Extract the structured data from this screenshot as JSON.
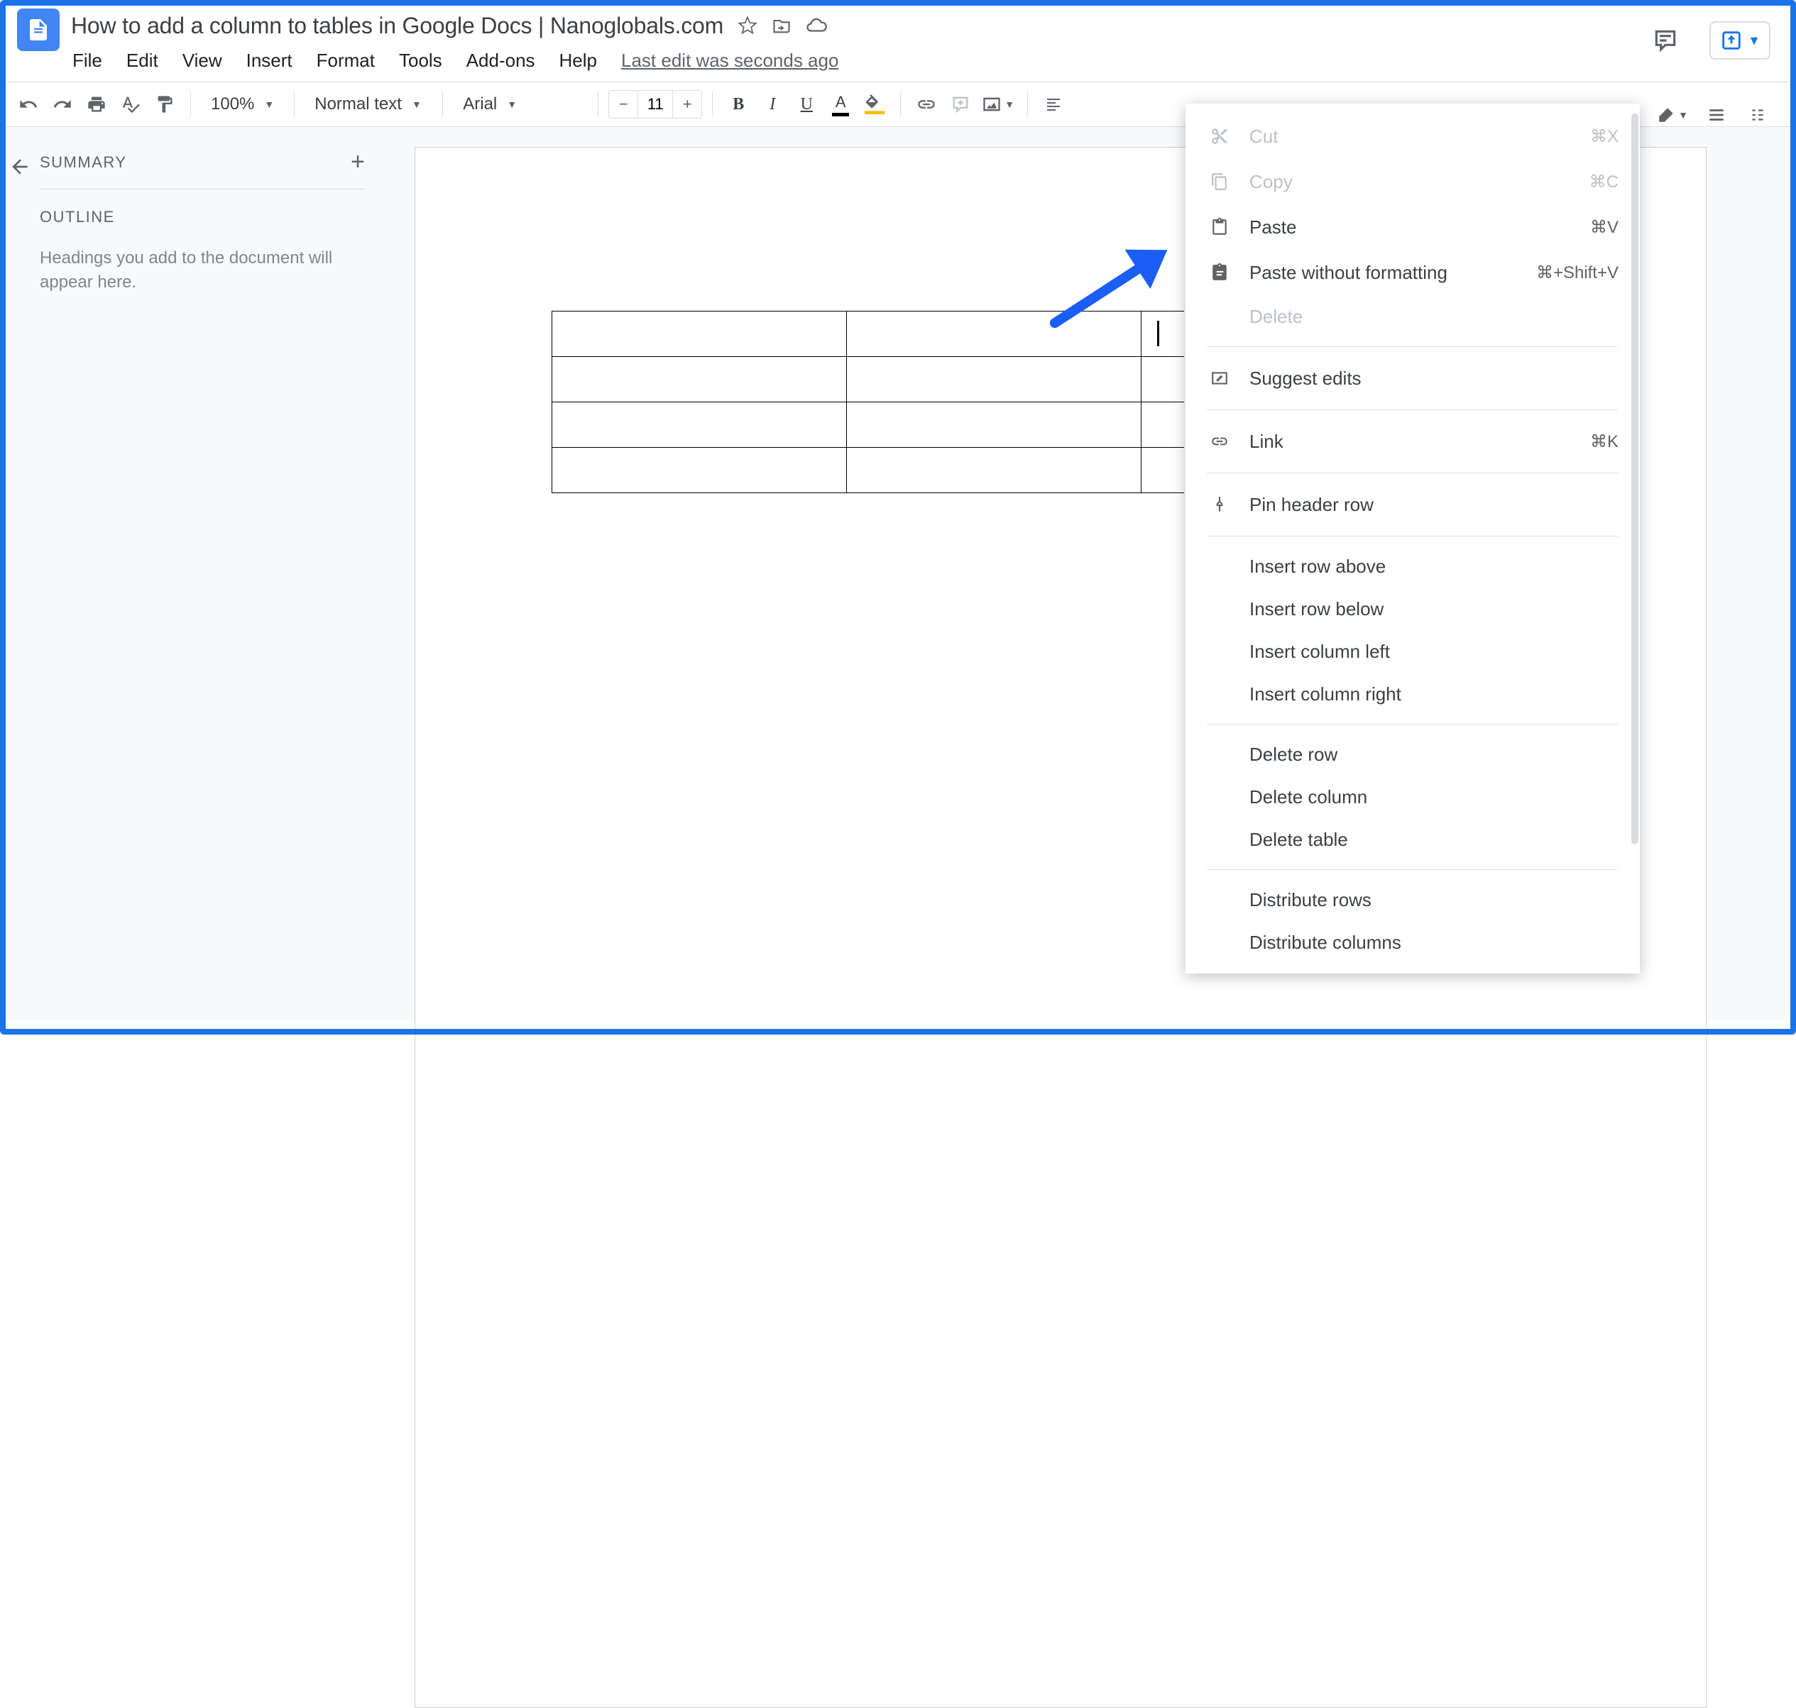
{
  "header": {
    "title": "How to add a column to tables in Google Docs | Nanoglobals.com",
    "menus": [
      "File",
      "Edit",
      "View",
      "Insert",
      "Format",
      "Tools",
      "Add-ons",
      "Help"
    ],
    "last_edit": "Last edit was seconds ago"
  },
  "toolbar": {
    "zoom": "100%",
    "style": "Normal text",
    "font": "Arial",
    "font_size": "11"
  },
  "outline": {
    "summary_label": "SUMMARY",
    "outline_label": "OUTLINE",
    "hint": "Headings you add to the document will appear here."
  },
  "context_menu": {
    "cut": {
      "label": "Cut",
      "shortcut": "⌘X"
    },
    "copy": {
      "label": "Copy",
      "shortcut": "⌘C"
    },
    "paste": {
      "label": "Paste",
      "shortcut": "⌘V"
    },
    "paste_nofmt": {
      "label": "Paste without formatting",
      "shortcut": "⌘+Shift+V"
    },
    "delete": {
      "label": "Delete"
    },
    "suggest": {
      "label": "Suggest edits"
    },
    "link": {
      "label": "Link",
      "shortcut": "⌘K"
    },
    "pin_header": {
      "label": "Pin header row"
    },
    "insert_row_above": {
      "label": "Insert row above"
    },
    "insert_row_below": {
      "label": "Insert row below"
    },
    "insert_col_left": {
      "label": "Insert column left"
    },
    "insert_col_right": {
      "label": "Insert column right"
    },
    "delete_row": {
      "label": "Delete row"
    },
    "delete_col": {
      "label": "Delete column"
    },
    "delete_table": {
      "label": "Delete table"
    },
    "dist_rows": {
      "label": "Distribute rows"
    },
    "dist_cols": {
      "label": "Distribute columns"
    }
  },
  "table": {
    "rows": 4,
    "cols": 3
  }
}
